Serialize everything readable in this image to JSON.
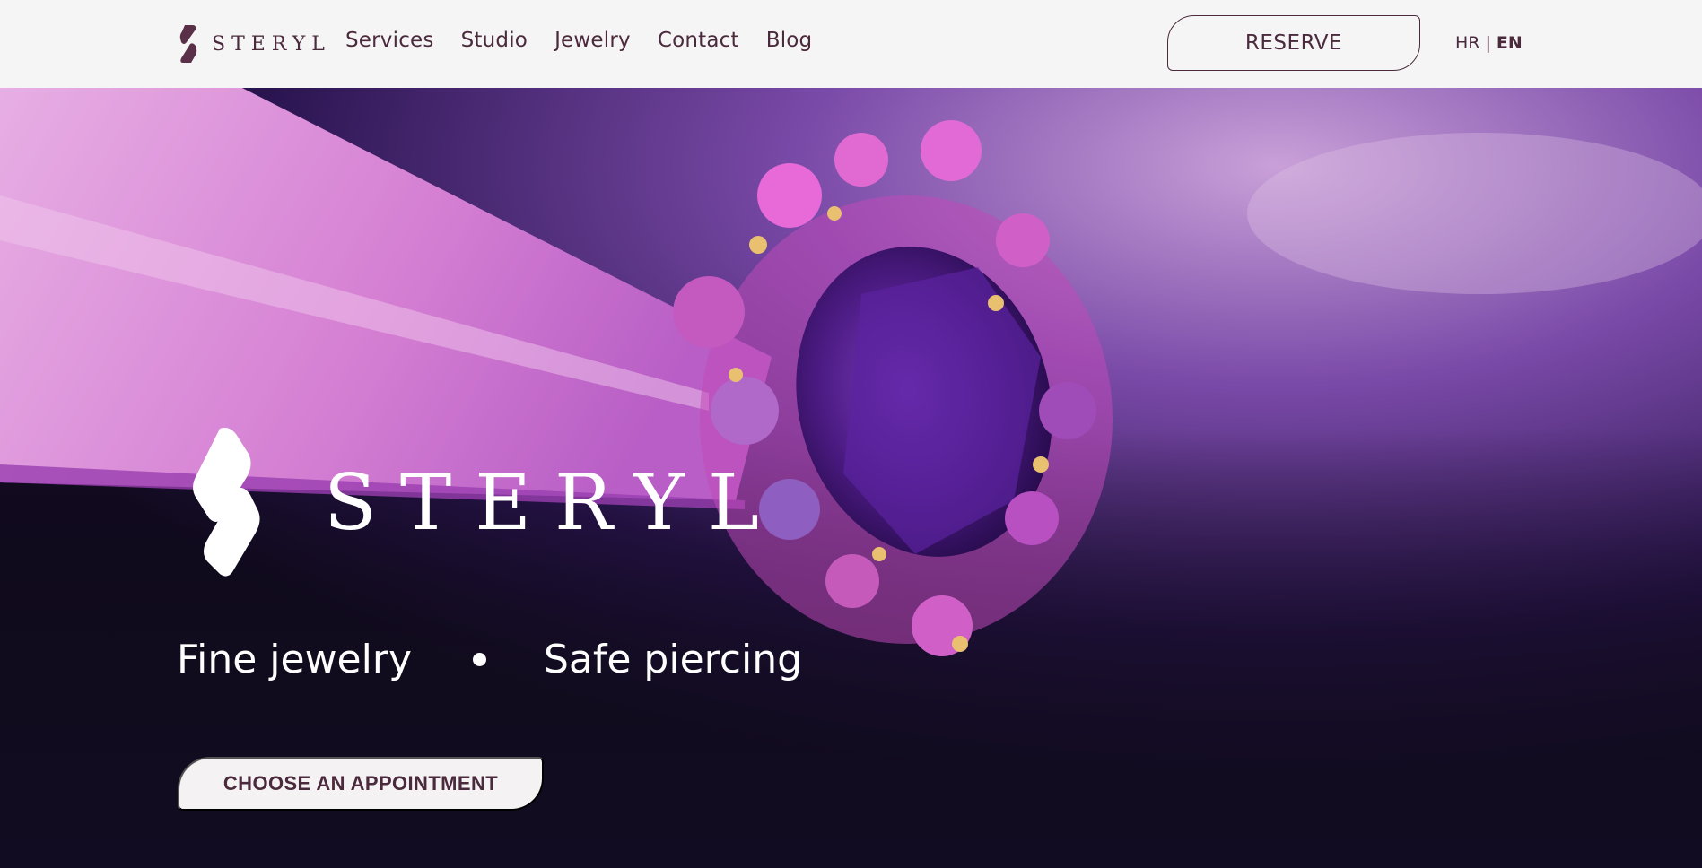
{
  "header": {
    "brand": "STERYL",
    "nav": [
      {
        "label": "Services"
      },
      {
        "label": "Studio"
      },
      {
        "label": "Jewelry"
      },
      {
        "label": "Contact"
      },
      {
        "label": "Blog"
      }
    ],
    "reserve_label": "RESERVE",
    "lang": {
      "hr": "HR",
      "sep": "|",
      "en": "EN",
      "active": "EN"
    }
  },
  "hero": {
    "logo_word": "STERYL",
    "tagline_left": "Fine jewelry",
    "tagline_right": "Safe piercing",
    "cta_label": "CHOOSE AN APPOINTMENT"
  },
  "colors": {
    "brand_text": "#4a2a3c",
    "header_bg": "#f6f5f5",
    "hero_dark": "#1a1030",
    "hero_pink": "#d67fd2",
    "gem_purple": "#5a1f8a"
  },
  "icons": {
    "brand_mark": "steryl-logo-mark",
    "hero_mark": "steryl-logo-mark-large",
    "tagline_separator": "bullet-dot"
  }
}
